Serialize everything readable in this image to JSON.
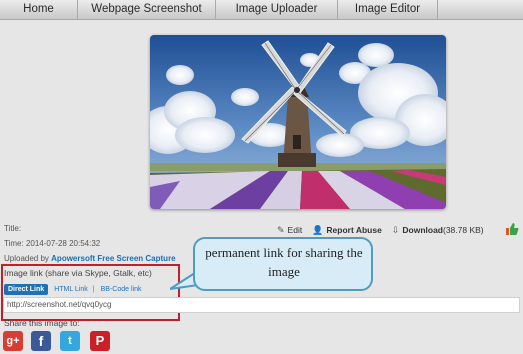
{
  "nav": {
    "items": [
      "Home",
      "Webpage Screenshot",
      "Image Uploader",
      "Image Editor"
    ]
  },
  "image": {
    "alt": "windmill"
  },
  "meta": {
    "title_label": "Title:",
    "time_label": "Time:",
    "time_value": "2014-07-28 20:54:32",
    "uploaded_label": "Uploaded by",
    "uploaded_by": "Apowersoft Free Screen Capture"
  },
  "actions": {
    "edit": "Edit",
    "report": "Report Abuse",
    "download": "Download",
    "download_size": "(38.78 KB)"
  },
  "image_link": {
    "title": "Image link (share via Skype, Gtalk, etc)",
    "tabs": [
      "Direct Link",
      "HTML Link",
      "BB-Code link"
    ],
    "separator": "|",
    "url": "http://screenshot.net/qvq0ycg"
  },
  "callout": {
    "text": "permanent link for sharing the image"
  },
  "share": {
    "title": "Share this image to:",
    "services": [
      {
        "label": "g+",
        "icon": "google-plus-icon",
        "color": "#d73d32"
      },
      {
        "label": "f",
        "icon": "facebook-icon",
        "color": "#3b5998"
      },
      {
        "label": "t",
        "icon": "twitter-icon",
        "color": "#34a8de"
      },
      {
        "label": "P",
        "icon": "pinterest-icon",
        "color": "#cb2027"
      }
    ]
  },
  "colors": {
    "accent": "#1d71b8",
    "highlight_border": "#c0202a",
    "callout_border": "#4e9cc4"
  }
}
